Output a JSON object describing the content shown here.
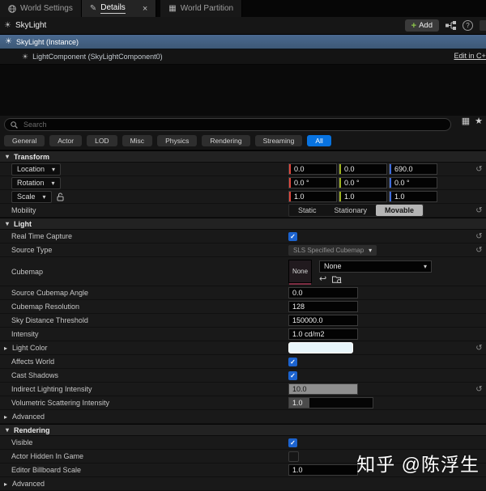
{
  "tabs": {
    "world_settings": "World Settings",
    "details": "Details",
    "world_partition": "World Partition"
  },
  "header": {
    "actor_name": "SkyLight",
    "add_label": "Add"
  },
  "tree": {
    "instance": "SkyLight (Instance)",
    "component": "LightComponent (SkyLightComponent0)",
    "edit_link": "Edit in C++"
  },
  "search": {
    "placeholder": "Search"
  },
  "filters": {
    "general": "General",
    "actor": "Actor",
    "lod": "LOD",
    "misc": "Misc",
    "physics": "Physics",
    "rendering": "Rendering",
    "streaming": "Streaming",
    "all": "All"
  },
  "transform": {
    "header": "Transform",
    "location": {
      "label": "Location",
      "x": "0.0",
      "y": "0.0",
      "z": "690.0"
    },
    "rotation": {
      "label": "Rotation",
      "x": "0.0 °",
      "y": "0.0 °",
      "z": "0.0 °"
    },
    "scale": {
      "label": "Scale",
      "x": "1.0",
      "y": "1.0",
      "z": "1.0"
    },
    "mobility": {
      "label": "Mobility",
      "static": "Static",
      "stationary": "Stationary",
      "movable": "Movable",
      "selected": "Movable"
    }
  },
  "light": {
    "header": "Light",
    "rtc": {
      "label": "Real Time Capture",
      "checked": "true"
    },
    "source_type": {
      "label": "Source Type",
      "value": "SLS Specified Cubemap"
    },
    "cubemap": {
      "label": "Cubemap",
      "thumb": "None",
      "value": "None"
    },
    "angle": {
      "label": "Source Cubemap Angle",
      "value": "0.0"
    },
    "resolution": {
      "label": "Cubemap Resolution",
      "value": "128"
    },
    "sky": {
      "label": "Sky Distance Threshold",
      "value": "150000.0"
    },
    "intensity": {
      "label": "Intensity",
      "value": "1.0 cd/m2"
    },
    "color": {
      "label": "Light Color",
      "swatch_hex": "#e8f5fa"
    },
    "affects": {
      "label": "Affects World",
      "checked": "true"
    },
    "shadows": {
      "label": "Cast Shadows",
      "checked": "true"
    },
    "indirect": {
      "label": "Indirect Lighting Intensity",
      "value": "10.0"
    },
    "volumetric": {
      "label": "Volumetric Scattering Intensity",
      "value": "1.0"
    },
    "advanced": "Advanced"
  },
  "rendering": {
    "header": "Rendering",
    "visible": {
      "label": "Visible",
      "checked": "true"
    },
    "hidden": {
      "label": "Actor Hidden In Game",
      "checked": "false"
    },
    "billboard": {
      "label": "Editor Billboard Scale",
      "value": "1.0"
    },
    "advanced": "Advanced"
  },
  "watermark": {
    "text": "知乎 @陈浮生"
  },
  "icons": {
    "close": "×",
    "plus": "+",
    "help": "?",
    "star": "★",
    "table": "▦",
    "pencil": "✎",
    "grid": "▦",
    "sun": "☀",
    "reset": "↺",
    "check": "✓",
    "caret_down": "▾",
    "caret_right": "▸",
    "use_arrow": "↩"
  },
  "colors": {
    "accent_blue": "#0873e0",
    "selected_row": "#41617e",
    "checkbox_blue": "#1c63cf",
    "axis_x": "#e0483e",
    "axis_y": "#9fb320",
    "axis_z": "#3f6ddc",
    "light_color": "#e8f5fa"
  }
}
